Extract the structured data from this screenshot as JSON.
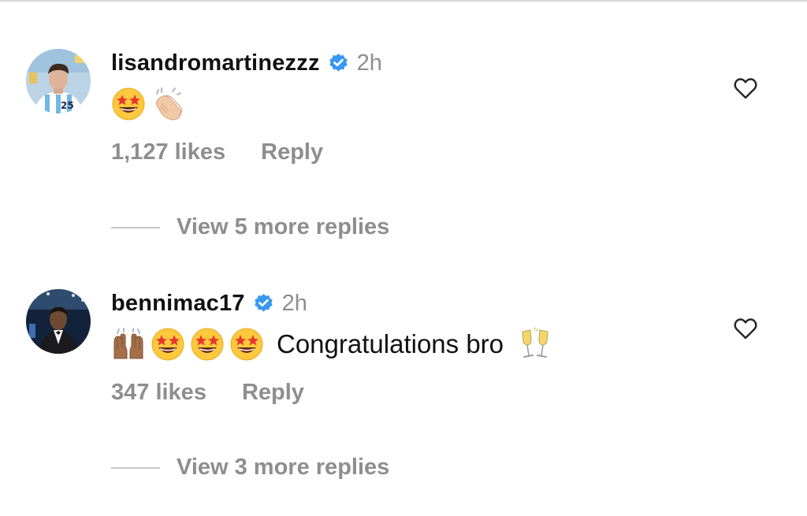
{
  "comments": [
    {
      "username": "lisandromartinezzz",
      "verified": true,
      "time": "2h",
      "emojis": [
        "star-struck",
        "clapping-hands"
      ],
      "text": "",
      "likes": "1,127 likes",
      "reply_label": "Reply",
      "view_replies": "View 5 more replies"
    },
    {
      "username": "bennimac17",
      "verified": true,
      "time": "2h",
      "emojis": [
        "raising-hands",
        "star-struck",
        "star-struck",
        "star-struck"
      ],
      "text": "Congratulations bro",
      "trailing_emoji": "clinking-glasses",
      "likes": "347 likes",
      "reply_label": "Reply",
      "view_replies": "View 3 more replies"
    }
  ],
  "colors": {
    "text": "#111111",
    "muted": "#8e8e8e",
    "verified_blue": "#3897f0",
    "divider": "#c7c7c7"
  },
  "icons": [
    "verified-badge-icon",
    "heart-outline-icon",
    "star-struck-emoji",
    "clapping-hands-emoji",
    "raising-hands-emoji",
    "clinking-glasses-emoji"
  ]
}
